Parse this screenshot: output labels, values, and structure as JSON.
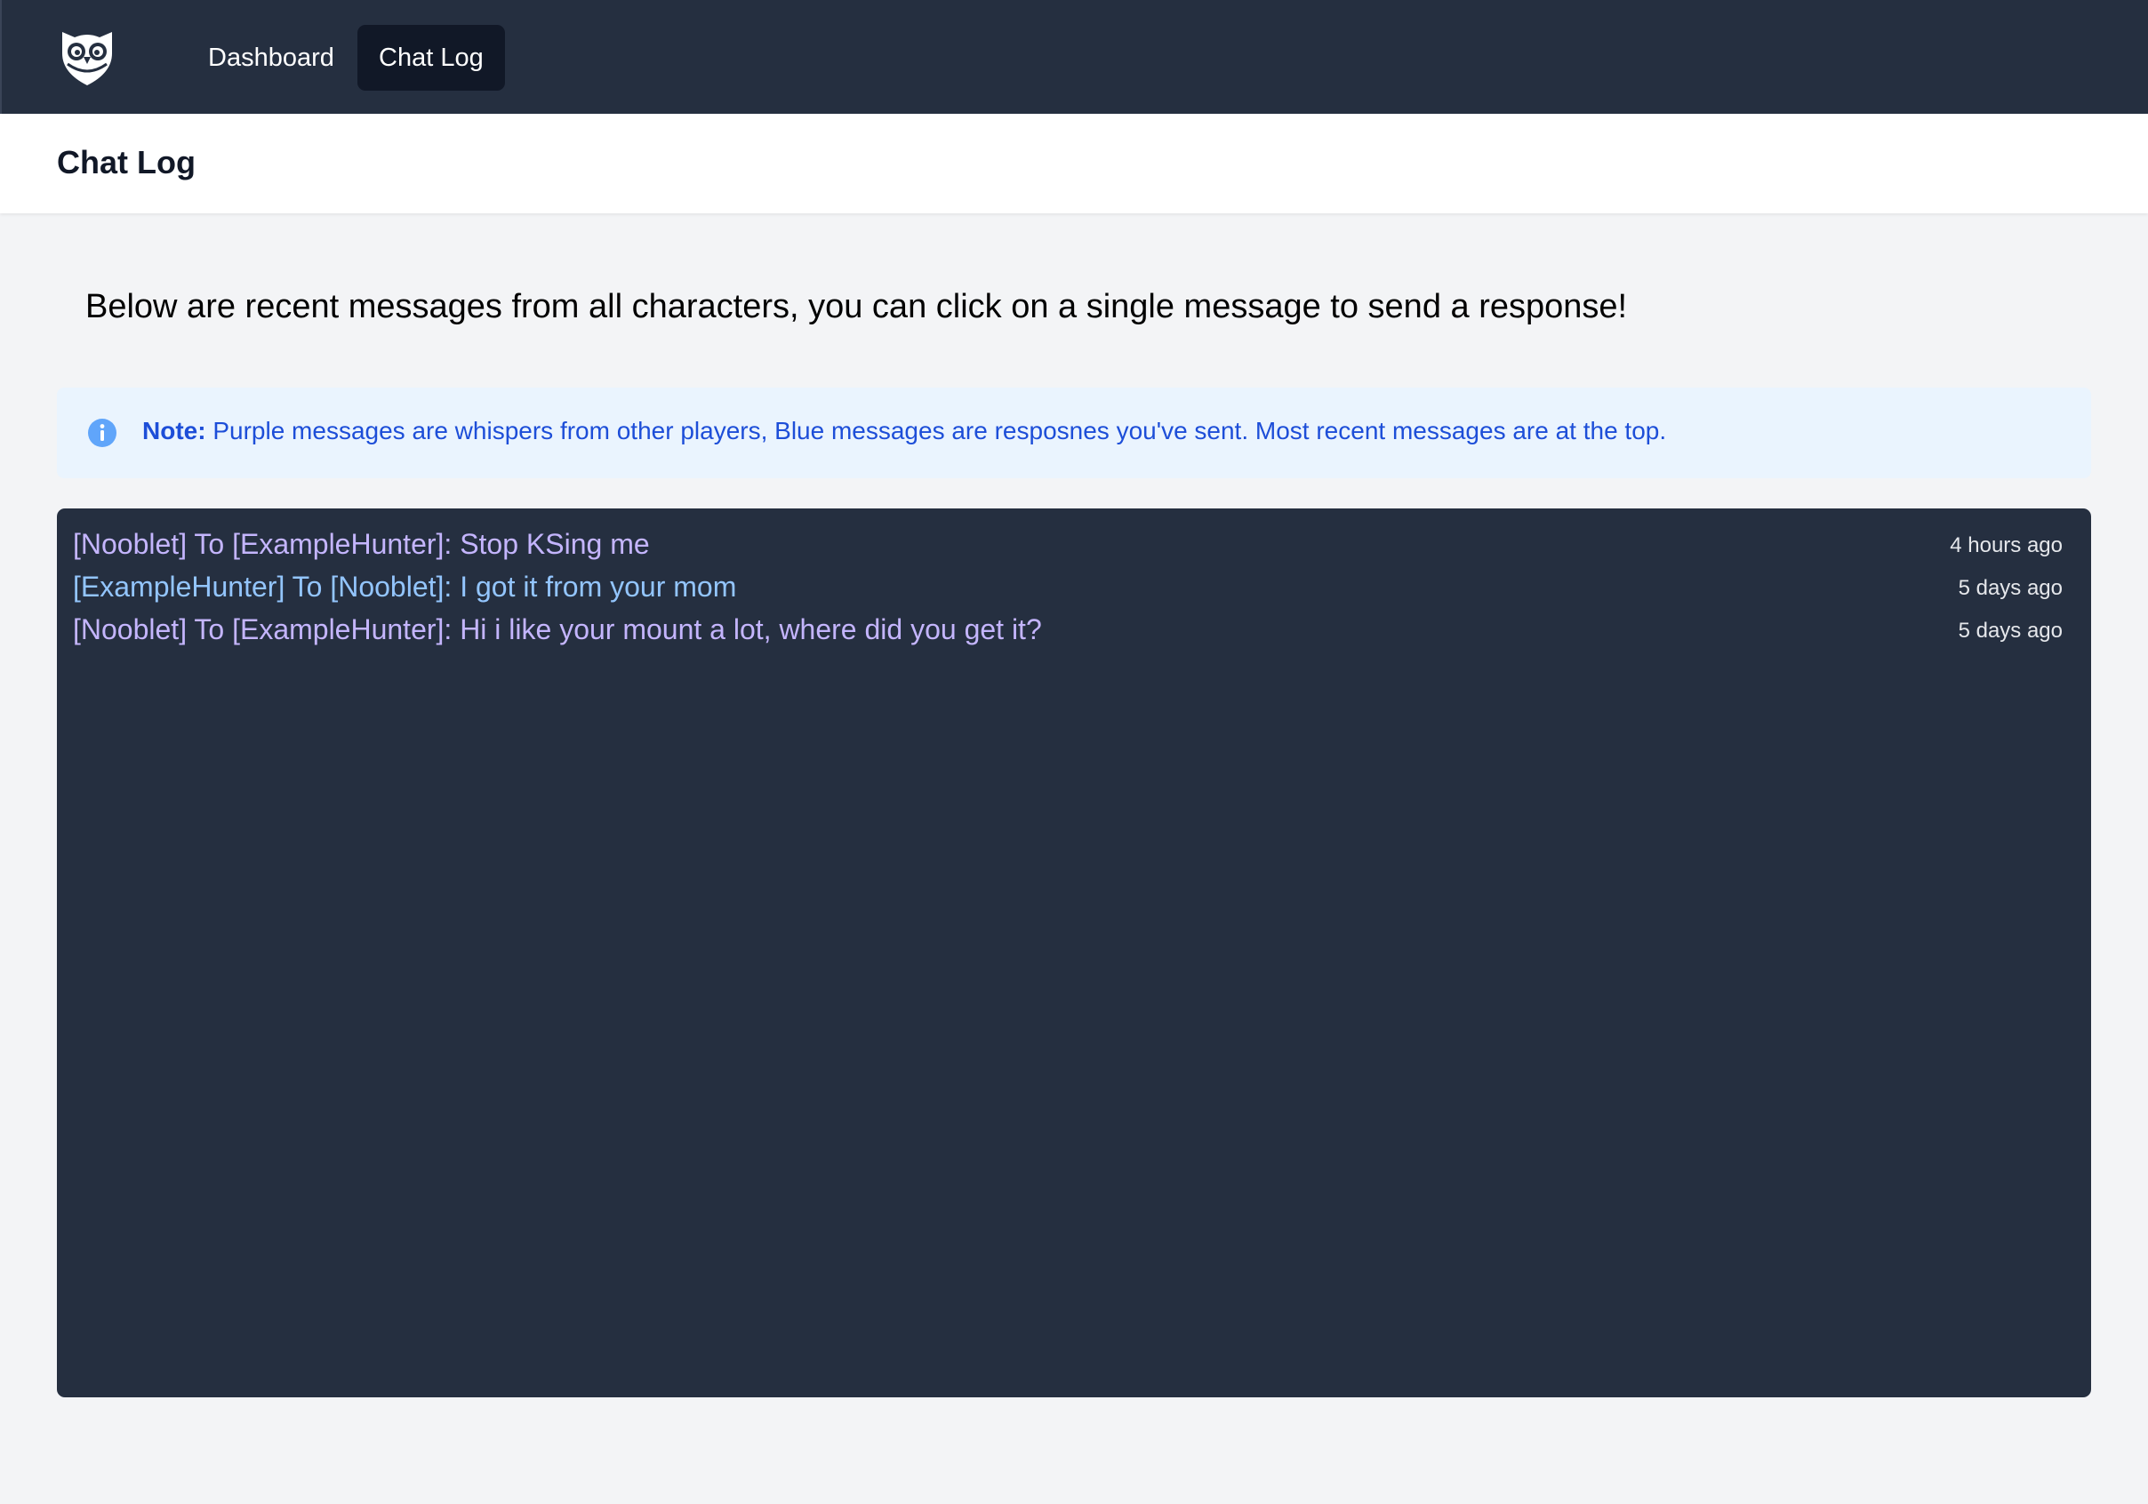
{
  "nav": {
    "logo_icon": "owl-shield-icon",
    "items": [
      {
        "label": "Dashboard",
        "active": false
      },
      {
        "label": "Chat Log",
        "active": true
      }
    ]
  },
  "header": {
    "title": "Chat Log"
  },
  "intro": "Below are recent messages from all characters, you can click on a single message to send a response!",
  "note": {
    "icon": "info-icon",
    "label": "Note:",
    "text": "Purple messages are whispers from other players, Blue messages are resposnes you've sent. Most recent messages are at the top."
  },
  "chat": {
    "messages": [
      {
        "text": "[Nooblet] To [ExampleHunter]: Stop KSing me",
        "time": "4 hours ago",
        "kind": "whisper"
      },
      {
        "text": "[ExampleHunter] To [Nooblet]: I got it from your mom",
        "time": "5 days ago",
        "kind": "response"
      },
      {
        "text": "[Nooblet] To [ExampleHunter]: Hi i like your mount a lot, where did you get it?",
        "time": "5 days ago",
        "kind": "whisper"
      }
    ]
  },
  "colors": {
    "nav_bg": "#252f40",
    "nav_active_bg": "#111827",
    "note_bg": "#eaf4fe",
    "note_text": "#1d4ed8",
    "whisper": "#c4b5fd",
    "response": "#93c5fd"
  }
}
